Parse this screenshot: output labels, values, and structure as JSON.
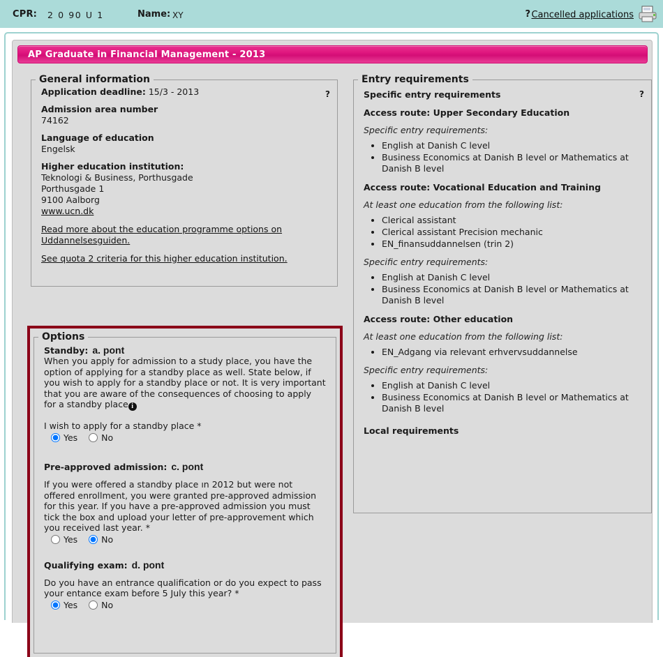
{
  "header": {
    "cpr_label": "CPR:",
    "cpr_value": "2 0 90 U 1",
    "name_label": "Name:",
    "name_value": "XY",
    "help_symbol": "?",
    "cancelled_link": "Cancelled applications",
    "printer_icon": "printer-icon",
    "background_color": "#abdbd9"
  },
  "title_bar": {
    "text": "AP Graduate in Financial Management - 2013",
    "accent_color": "#e0177f"
  },
  "general_information": {
    "legend": "General information",
    "help_symbol": "?",
    "application_deadline_label": "Application deadline:",
    "application_deadline_value": "15/3 - 2013",
    "admission_area_label": "Admission area number",
    "admission_area_value": "74162",
    "language_label": "Language of education",
    "language_value": "Engelsk",
    "institution_label": "Higher education institution:",
    "institution_name": "Teknologi & Business, Porthusgade",
    "institution_street": "Porthusgade 1",
    "institution_city": "9100 Aalborg",
    "institution_web": "www.ucn.dk",
    "link_read_more": "Read more about the education programme options on Uddannelsesguiden.",
    "link_quota": "See quota 2 criteria for this higher education institution."
  },
  "options": {
    "legend": "Options",
    "highlight_color": "#8b0018",
    "standby": {
      "heading": "Standby:",
      "annotation": "a. pont",
      "description": "When you apply for admission to a study place, you have the option of applying for a standby place as well. State below, if you wish to apply for a standby place or not. It is very important that you are aware of the consequences of choosing to apply for a standby place",
      "info_icon": "info-icon",
      "question": "I wish to apply for a standby place *",
      "yes_label": "Yes",
      "no_label": "No",
      "selected": "Yes"
    },
    "preapproved": {
      "heading": "Pre-approved admission:",
      "annotation": "c. pont",
      "description": "If you were offered a standby place ın 2012 but were not offered enrollment, you were granted pre-approved admission for this year. If you have a pre-approved admission you must tick the box and upload your letter of pre-approvement which you received last year. *",
      "yes_label": "Yes",
      "no_label": "No",
      "selected": "No"
    },
    "qualifying": {
      "heading": "Qualifying exam:",
      "annotation": "d. pont",
      "description": "Do you have an entrance qualification or do you expect to pass your entance exam before 5 July this year? *",
      "yes_label": "Yes",
      "no_label": "No",
      "selected": "Yes"
    }
  },
  "entry_requirements": {
    "legend": "Entry requirements",
    "help_symbol": "?",
    "heading": "Specific entry requirements",
    "routes": [
      {
        "title": "Access route: Upper Secondary Education",
        "blocks": [
          {
            "caption": "Specific entry requirements:",
            "items": [
              "English at Danish C level",
              "Business Economics at Danish B level or Mathematics at Danish B level"
            ]
          }
        ]
      },
      {
        "title": "Access route: Vocational Education and Training",
        "blocks": [
          {
            "caption": "At least one education from the following list:",
            "items": [
              "Clerical assistant",
              "Clerical assistant Precision mechanic",
              "EN_finansuddannelsen (trin 2)"
            ]
          },
          {
            "caption": "Specific entry requirements:",
            "items": [
              "English at Danish C level",
              "Business Economics at Danish B level or Mathematics at Danish B level"
            ]
          }
        ]
      },
      {
        "title": "Access route: Other education",
        "blocks": [
          {
            "caption": "At least one education from the following list:",
            "items": [
              "EN_Adgang via relevant erhvervsuddannelse"
            ]
          },
          {
            "caption": "Specific entry requirements:",
            "items": [
              "English at Danish C level",
              "Business Economics at Danish B level or Mathematics at Danish B level"
            ]
          }
        ]
      }
    ],
    "local_requirements": "Local requirements"
  }
}
